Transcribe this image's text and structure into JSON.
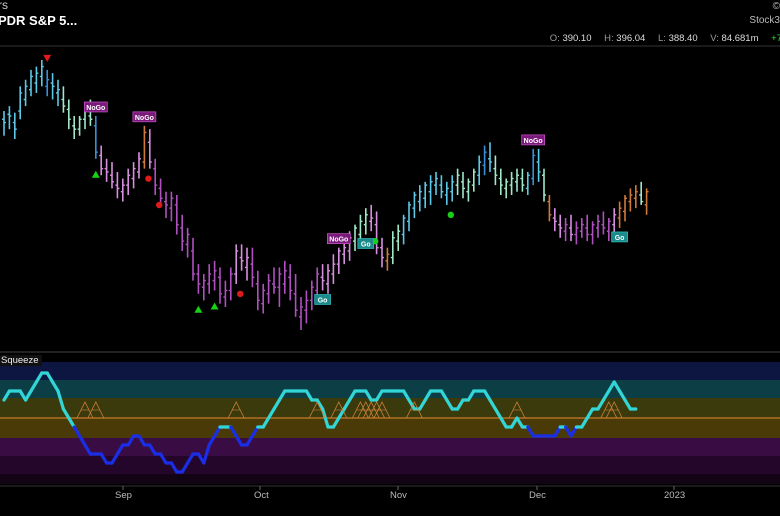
{
  "header": {
    "title": "rs",
    "name": "PDR S&P 5...",
    "logo_top": "©",
    "logo_bottom": "Stock3"
  },
  "ohlc": {
    "o_label": "O:",
    "o": "390.10",
    "h_label": "H:",
    "h": "396.04",
    "l_label": "L:",
    "l": "388.40",
    "v_label": "V:",
    "v": "84.681m",
    "chg": "+7"
  },
  "indicator": {
    "label": "Squeeze"
  },
  "colors": {
    "go_strong": "#3a8fd9",
    "go": "#5cc8e8",
    "go_weak": "#9fe8c8",
    "nogo_weak": "#d88ee0",
    "nogo": "#b050c0",
    "nogo_strong": "#7a2a8a",
    "amber": "#d07a3a",
    "osc_cyan": "#33d6d6",
    "osc_blue": "#1a2ee6",
    "zero_line": "#c87a2a"
  },
  "chart_data": [
    {
      "type": "bar",
      "subtype": "ohlc-price",
      "x_axis_labels": [
        "Sep",
        "Oct",
        "Nov",
        "Dec",
        "2023"
      ],
      "bars": [
        [
          450,
          455,
          440,
          448,
          "go"
        ],
        [
          453,
          458,
          444,
          452,
          "go"
        ],
        [
          448,
          454,
          438,
          444,
          "go"
        ],
        [
          455,
          470,
          450,
          466,
          "go"
        ],
        [
          462,
          474,
          458,
          470,
          "go"
        ],
        [
          468,
          480,
          464,
          476,
          "go"
        ],
        [
          472,
          482,
          466,
          478,
          "go"
        ],
        [
          476,
          486,
          470,
          482,
          "go"
        ],
        [
          470,
          480,
          464,
          474,
          "go_strong"
        ],
        [
          472,
          478,
          462,
          470,
          "go"
        ],
        [
          466,
          474,
          458,
          468,
          "go"
        ],
        [
          462,
          470,
          454,
          458,
          "go_weak"
        ],
        [
          456,
          462,
          444,
          450,
          "go_weak"
        ],
        [
          446,
          452,
          438,
          444,
          "go_weak"
        ],
        [
          444,
          452,
          440,
          450,
          "go_weak"
        ],
        [
          450,
          460,
          444,
          456,
          "go_weak"
        ],
        [
          452,
          462,
          446,
          450,
          "go_weak"
        ],
        [
          446,
          452,
          426,
          430,
          "go_strong"
        ],
        [
          428,
          434,
          416,
          420,
          "nogo_weak"
        ],
        [
          420,
          426,
          412,
          418,
          "nogo_weak"
        ],
        [
          416,
          424,
          408,
          412,
          "nogo_weak"
        ],
        [
          410,
          418,
          402,
          408,
          "nogo_weak"
        ],
        [
          406,
          414,
          400,
          410,
          "nogo_weak"
        ],
        [
          410,
          420,
          404,
          416,
          "nogo_weak"
        ],
        [
          414,
          424,
          408,
          420,
          "nogo_weak"
        ],
        [
          418,
          430,
          414,
          426,
          "nogo_weak"
        ],
        [
          424,
          446,
          420,
          442,
          "amber"
        ],
        [
          436,
          444,
          420,
          424,
          "nogo_weak"
        ],
        [
          420,
          426,
          404,
          410,
          "nogo"
        ],
        [
          408,
          414,
          398,
          402,
          "nogo"
        ],
        [
          400,
          406,
          390,
          398,
          "nogo"
        ],
        [
          396,
          406,
          388,
          402,
          "nogo"
        ],
        [
          398,
          404,
          380,
          386,
          "nogo"
        ],
        [
          384,
          392,
          370,
          376,
          "nogo"
        ],
        [
          374,
          384,
          366,
          380,
          "nogo"
        ],
        [
          370,
          378,
          352,
          356,
          "nogo"
        ],
        [
          356,
          362,
          344,
          350,
          "nogo"
        ],
        [
          348,
          356,
          340,
          352,
          "nogo"
        ],
        [
          350,
          362,
          344,
          356,
          "nogo"
        ],
        [
          352,
          364,
          346,
          358,
          "nogo"
        ],
        [
          354,
          360,
          338,
          344,
          "nogo"
        ],
        [
          342,
          352,
          336,
          346,
          "nogo"
        ],
        [
          346,
          360,
          340,
          356,
          "nogo"
        ],
        [
          356,
          374,
          350,
          370,
          "nogo_weak"
        ],
        [
          366,
          374,
          358,
          364,
          "nogo_weak"
        ],
        [
          360,
          372,
          352,
          366,
          "nogo_weak"
        ],
        [
          362,
          372,
          348,
          354,
          "nogo"
        ],
        [
          350,
          358,
          334,
          340,
          "nogo"
        ],
        [
          338,
          350,
          332,
          346,
          "nogo"
        ],
        [
          344,
          356,
          338,
          352,
          "nogo"
        ],
        [
          350,
          360,
          344,
          348,
          "nogo"
        ],
        [
          348,
          360,
          336,
          356,
          "nogo"
        ],
        [
          350,
          364,
          344,
          358,
          "nogo"
        ],
        [
          354,
          362,
          340,
          346,
          "nogo"
        ],
        [
          344,
          356,
          330,
          334,
          "nogo"
        ],
        [
          330,
          342,
          322,
          336,
          "nogo"
        ],
        [
          334,
          346,
          326,
          340,
          "nogo"
        ],
        [
          340,
          352,
          334,
          348,
          "nogo"
        ],
        [
          346,
          360,
          340,
          356,
          "nogo"
        ],
        [
          354,
          362,
          346,
          352,
          "nogo_weak"
        ],
        [
          350,
          362,
          344,
          358,
          "nogo_weak"
        ],
        [
          356,
          368,
          350,
          362,
          "nogo_weak"
        ],
        [
          362,
          372,
          356,
          370,
          "nogo_weak"
        ],
        [
          368,
          378,
          362,
          372,
          "nogo_weak"
        ],
        [
          370,
          382,
          364,
          378,
          "nogo_weak"
        ],
        [
          376,
          386,
          370,
          384,
          "go_weak"
        ],
        [
          380,
          392,
          374,
          388,
          "go_weak"
        ],
        [
          386,
          396,
          380,
          392,
          "go_weak"
        ],
        [
          388,
          398,
          382,
          390,
          "nogo_weak"
        ],
        [
          386,
          394,
          368,
          372,
          "nogo_weak"
        ],
        [
          372,
          378,
          360,
          366,
          "nogo_weak"
        ],
        [
          364,
          372,
          358,
          368,
          "amber"
        ],
        [
          366,
          382,
          362,
          378,
          "go_weak"
        ],
        [
          376,
          386,
          370,
          382,
          "go_weak"
        ],
        [
          380,
          392,
          374,
          390,
          "go"
        ],
        [
          388,
          400,
          382,
          398,
          "go"
        ],
        [
          396,
          406,
          390,
          404,
          "go"
        ],
        [
          400,
          410,
          394,
          406,
          "go"
        ],
        [
          402,
          412,
          396,
          410,
          "go"
        ],
        [
          406,
          416,
          398,
          412,
          "go"
        ],
        [
          410,
          418,
          404,
          414,
          "go"
        ],
        [
          410,
          416,
          402,
          406,
          "go"
        ],
        [
          404,
          412,
          398,
          408,
          "go"
        ],
        [
          406,
          416,
          400,
          412,
          "go"
        ],
        [
          410,
          420,
          404,
          416,
          "go_weak"
        ],
        [
          412,
          418,
          402,
          408,
          "go_weak"
        ],
        [
          406,
          414,
          400,
          412,
          "go_weak"
        ],
        [
          410,
          420,
          406,
          418,
          "go_weak"
        ],
        [
          416,
          428,
          410,
          424,
          "go"
        ],
        [
          422,
          434,
          416,
          430,
          "go_strong"
        ],
        [
          426,
          436,
          418,
          424,
          "go"
        ],
        [
          420,
          428,
          410,
          416,
          "go_weak"
        ],
        [
          414,
          420,
          404,
          410,
          "go_weak"
        ],
        [
          408,
          414,
          402,
          412,
          "go_weak"
        ],
        [
          410,
          418,
          404,
          414,
          "go_weak"
        ],
        [
          412,
          420,
          406,
          416,
          "go_weak"
        ],
        [
          414,
          420,
          406,
          410,
          "go_weak"
        ],
        [
          408,
          418,
          404,
          416,
          "go"
        ],
        [
          414,
          432,
          410,
          428,
          "go_strong"
        ],
        [
          424,
          432,
          412,
          418,
          "go"
        ],
        [
          416,
          420,
          400,
          404,
          "go_weak"
        ],
        [
          400,
          404,
          388,
          392,
          "amber"
        ],
        [
          390,
          396,
          382,
          388,
          "nogo_weak"
        ],
        [
          386,
          392,
          378,
          384,
          "nogo_weak"
        ],
        [
          382,
          390,
          376,
          386,
          "nogo"
        ],
        [
          384,
          392,
          376,
          380,
          "nogo_weak"
        ],
        [
          380,
          388,
          374,
          384,
          "nogo"
        ],
        [
          382,
          390,
          378,
          386,
          "nogo"
        ],
        [
          384,
          392,
          376,
          380,
          "nogo"
        ],
        [
          380,
          388,
          374,
          386,
          "nogo"
        ],
        [
          384,
          392,
          378,
          388,
          "nogo"
        ],
        [
          386,
          394,
          380,
          384,
          "nogo"
        ],
        [
          382,
          390,
          376,
          388,
          "nogo"
        ],
        [
          386,
          396,
          380,
          392,
          "nogo_weak"
        ],
        [
          390,
          400,
          384,
          396,
          "amber"
        ],
        [
          394,
          404,
          388,
          402,
          "amber"
        ],
        [
          400,
          408,
          394,
          404,
          "amber"
        ],
        [
          402,
          410,
          396,
          406,
          "amber"
        ],
        [
          404,
          412,
          398,
          400,
          "go_weak"
        ],
        [
          398,
          408,
          392,
          406,
          "amber"
        ]
      ],
      "signals": [
        {
          "kind": "down-triangle",
          "bar": 8,
          "color": "#e01a1a"
        },
        {
          "kind": "up-triangle",
          "bar": 17,
          "color": "#18d018"
        },
        {
          "kind": "dot",
          "bar": 26,
          "color": "#e01a1a"
        },
        {
          "kind": "dot",
          "bar": 28,
          "color": "#e01a1a"
        },
        {
          "kind": "up-triangle",
          "bar": 36,
          "color": "#18d018"
        },
        {
          "kind": "up-triangle",
          "bar": 39,
          "color": "#18d018"
        },
        {
          "kind": "dot",
          "bar": 43,
          "color": "#e01a1a"
        },
        {
          "kind": "dot",
          "bar": 68,
          "color": "#18d018"
        },
        {
          "kind": "dot",
          "bar": 82,
          "color": "#18d018"
        }
      ],
      "labels": [
        {
          "text": "NoGo",
          "bar": 17,
          "type": "nogo"
        },
        {
          "text": "NoGo",
          "bar": 26,
          "type": "nogo"
        },
        {
          "text": "NoGo",
          "bar": 62,
          "type": "nogo"
        },
        {
          "text": "Go",
          "bar": 59,
          "type": "go"
        },
        {
          "text": "Go",
          "bar": 67,
          "type": "go"
        },
        {
          "text": "NoGo",
          "bar": 98,
          "type": "nogo"
        },
        {
          "text": "Go",
          "bar": 114,
          "type": "go"
        }
      ]
    },
    {
      "type": "line",
      "subtype": "oscillator",
      "values": [
        2,
        3,
        3,
        3,
        2,
        3,
        4,
        5,
        5,
        4,
        3,
        1,
        0,
        -1,
        -2,
        -3,
        -4,
        -4,
        -4,
        -5,
        -5,
        -4,
        -3,
        -3,
        -2,
        -2,
        -3,
        -3,
        -4,
        -4,
        -5,
        -5,
        -6,
        -6,
        -5,
        -4,
        -4,
        -5,
        -3,
        -2,
        -1,
        -1,
        -1,
        -2,
        -3,
        -3,
        -2,
        -1,
        -1,
        0,
        1,
        2,
        3,
        3,
        3,
        3,
        3,
        2,
        2,
        1,
        -1,
        -1,
        0,
        1,
        2,
        3,
        3,
        3,
        2,
        2,
        3,
        3,
        3,
        3,
        3,
        2,
        1,
        1,
        2,
        3,
        3,
        3,
        2,
        1,
        1,
        2,
        2,
        3,
        3,
        3,
        2,
        1,
        0,
        -1,
        -1,
        0,
        -1,
        -1,
        -2,
        -2,
        -2,
        -2,
        -2,
        -1,
        -1,
        -2,
        -1,
        -1,
        0,
        1,
        1,
        2,
        3,
        4,
        3,
        2,
        1,
        1
      ],
      "squeeze_marks": [
        15,
        17,
        43,
        58,
        62,
        66,
        67,
        68,
        69,
        70,
        76,
        95,
        112,
        113
      ]
    }
  ]
}
